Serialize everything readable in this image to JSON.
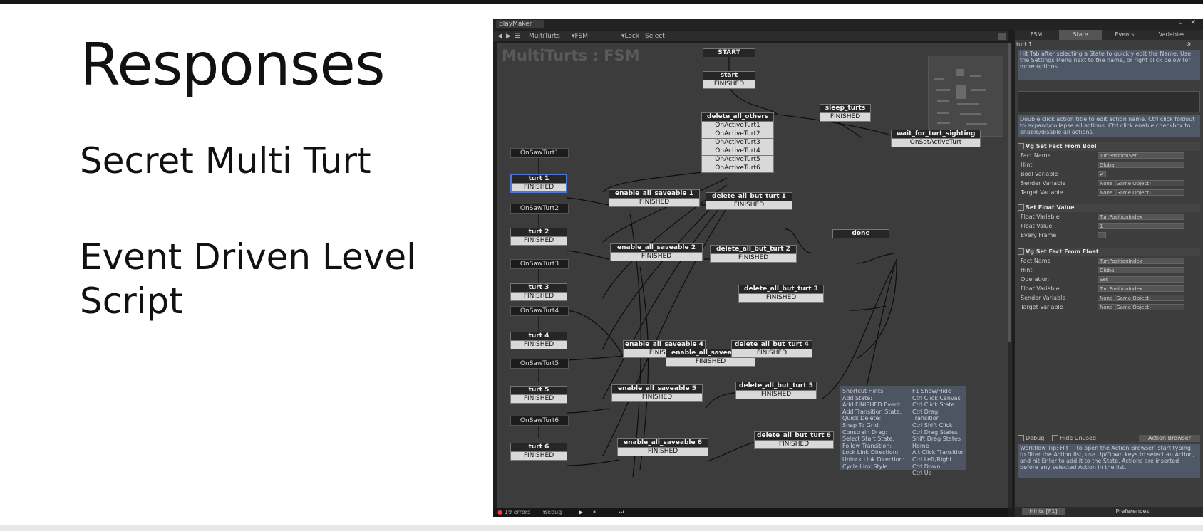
{
  "slide": {
    "title": "Responses",
    "bullet1": "Secret Multi Turt",
    "bullet2": "Event Driven Level Script"
  },
  "playmaker": {
    "window_tab": "playMaker",
    "toolbar": {
      "fsm_name": "MultiTurts",
      "fsm_dropdown": "FSM",
      "lock": "Lock",
      "select": "Select"
    },
    "graph_title": "MultiTurts : FSM",
    "global_events": [
      "OnSawTurt1",
      "OnSawTurt2",
      "OnSawTurt3",
      "OnSawTurt4",
      "OnSawTurt5",
      "OnSawTurt6"
    ],
    "states": {
      "start_label": "START",
      "start": {
        "name": "start",
        "transitions": [
          "FINISHED"
        ]
      },
      "sleep_turts": {
        "name": "sleep_turts",
        "transitions": [
          "FINISHED"
        ]
      },
      "wait_for_turt_sighting": {
        "name": "wait_for_turt_sighting",
        "transitions": [
          "OnSetActiveTurt"
        ]
      },
      "delete_all_others": {
        "name": "delete_all_others",
        "transitions": [
          "OnActiveTurt1",
          "OnActiveTurt2",
          "OnActiveTurt3",
          "OnActiveTurt4",
          "OnActiveTurt5",
          "OnActiveTurt6"
        ]
      },
      "done": {
        "name": "done"
      },
      "turt": [
        {
          "name": "turt 1",
          "t": "FINISHED"
        },
        {
          "name": "turt 2",
          "t": "FINISHED"
        },
        {
          "name": "turt 3",
          "t": "FINISHED"
        },
        {
          "name": "turt 4",
          "t": "FINISHED"
        },
        {
          "name": "turt 5",
          "t": "FINISHED"
        },
        {
          "name": "turt 6",
          "t": "FINISHED"
        }
      ],
      "enable": [
        {
          "name": "enable_all_saveable 1",
          "t": "FINISHED"
        },
        {
          "name": "enable_all_saveable 2",
          "t": "FINISHED"
        },
        {
          "name": "enable_all_saveable 3",
          "t": "FINISHED"
        },
        {
          "name": "enable_all_saveable 4",
          "t": "FINISHED"
        },
        {
          "name": "enable_all_saveable 5",
          "t": "FINISHED"
        },
        {
          "name": "enable_all_saveable 6",
          "t": "FINISHED"
        }
      ],
      "delete_but": [
        {
          "name": "delete_all_but_turt 1",
          "t": "FINISHED"
        },
        {
          "name": "delete_all_but_turt 2",
          "t": "FINISHED"
        },
        {
          "name": "delete_all_but_turt 3",
          "t": "FINISHED"
        },
        {
          "name": "delete_all_but_turt 4",
          "t": "FINISHED"
        },
        {
          "name": "delete_all_but_turt 5",
          "t": "FINISHED"
        },
        {
          "name": "delete_all_but_turt 6",
          "t": "FINISHED"
        }
      ]
    },
    "hints": {
      "keys": [
        "Shortcut Hints:",
        "Add State:",
        "Add FINISHED Event:",
        "Add Transition State:",
        "Quick Delete:",
        "Snap To Grid:",
        "Constrain Drag:",
        "Select Start State:",
        "Follow Transition:",
        "Lock Link Direction:",
        "Unlock Link Direction:",
        "Cycle Link Style:"
      ],
      "values": [
        "F1 Show/Hide",
        "Ctrl Click Canvas",
        "Ctrl Click State",
        "Ctrl Drag Transition",
        "Ctrl Shift Click",
        "Ctrl Drag States",
        "Shift Drag States",
        "Home",
        "Alt Click Transition",
        "Ctrl Left/Right",
        "Ctrl Down",
        "Ctrl Up"
      ]
    },
    "status": {
      "errors": "19 errors",
      "debug": "Debug",
      "play_icon": "play-icon",
      "pause_icon": "pause-icon",
      "step_icon": "step-icon"
    }
  },
  "inspector": {
    "tabs": [
      "FSM",
      "State",
      "Events",
      "Variables"
    ],
    "active_tab": "State",
    "state_name": "turt 1",
    "info": "Hit Tab after selecting a State to quickly edit the Name. Use the Settings Menu next to the name, or right click below for more options.",
    "info2": "Double click action title to edit action name. Ctrl click foldout to expand/collapse all actions. Ctrl click enable checkbox to enable/disable all actions.",
    "actions": [
      {
        "title": "Vg Set Fact From Bool",
        "rows": [
          {
            "k": "Fact Name",
            "v": "TurtPositionSet"
          },
          {
            "k": "Hint",
            "v": "Global"
          },
          {
            "k": "Bool Variable",
            "v": "✔"
          },
          {
            "k": "Sender Variable",
            "v": "None (Game Object)"
          },
          {
            "k": "Target Variable",
            "v": "None (Game Object)"
          }
        ]
      },
      {
        "title": "Set Float Value",
        "rows": [
          {
            "k": "Float Variable",
            "v": "TurtPositionIndex"
          },
          {
            "k": "Float Value",
            "v": "1"
          },
          {
            "k": "Every Frame",
            "v": ""
          }
        ]
      },
      {
        "title": "Vg Set Fact From Float",
        "rows": [
          {
            "k": "Fact Name",
            "v": "TurtPositionIndex"
          },
          {
            "k": "Hint",
            "v": "Global"
          },
          {
            "k": "Operation",
            "v": "Set"
          },
          {
            "k": "Float Variable",
            "v": "TurtPositionIndex"
          },
          {
            "k": "Sender Variable",
            "v": "None (Game Object)"
          },
          {
            "k": "Target Variable",
            "v": "None (Game Object)"
          }
        ]
      }
    ],
    "debug_label": "Debug",
    "hide_unused_label": "Hide Unused",
    "action_browser": "Action Browser",
    "workflow_tip": "Workflow Tip: Hit ~ to open the Action Browser, start typing to filter the Action list, use Up/Down keys to select an Action, and hit Enter to add it to the State. Actions are inserted before any selected Action in the list.",
    "footer_hints": "Hints [F1]",
    "footer_prefs": "Preferences"
  }
}
